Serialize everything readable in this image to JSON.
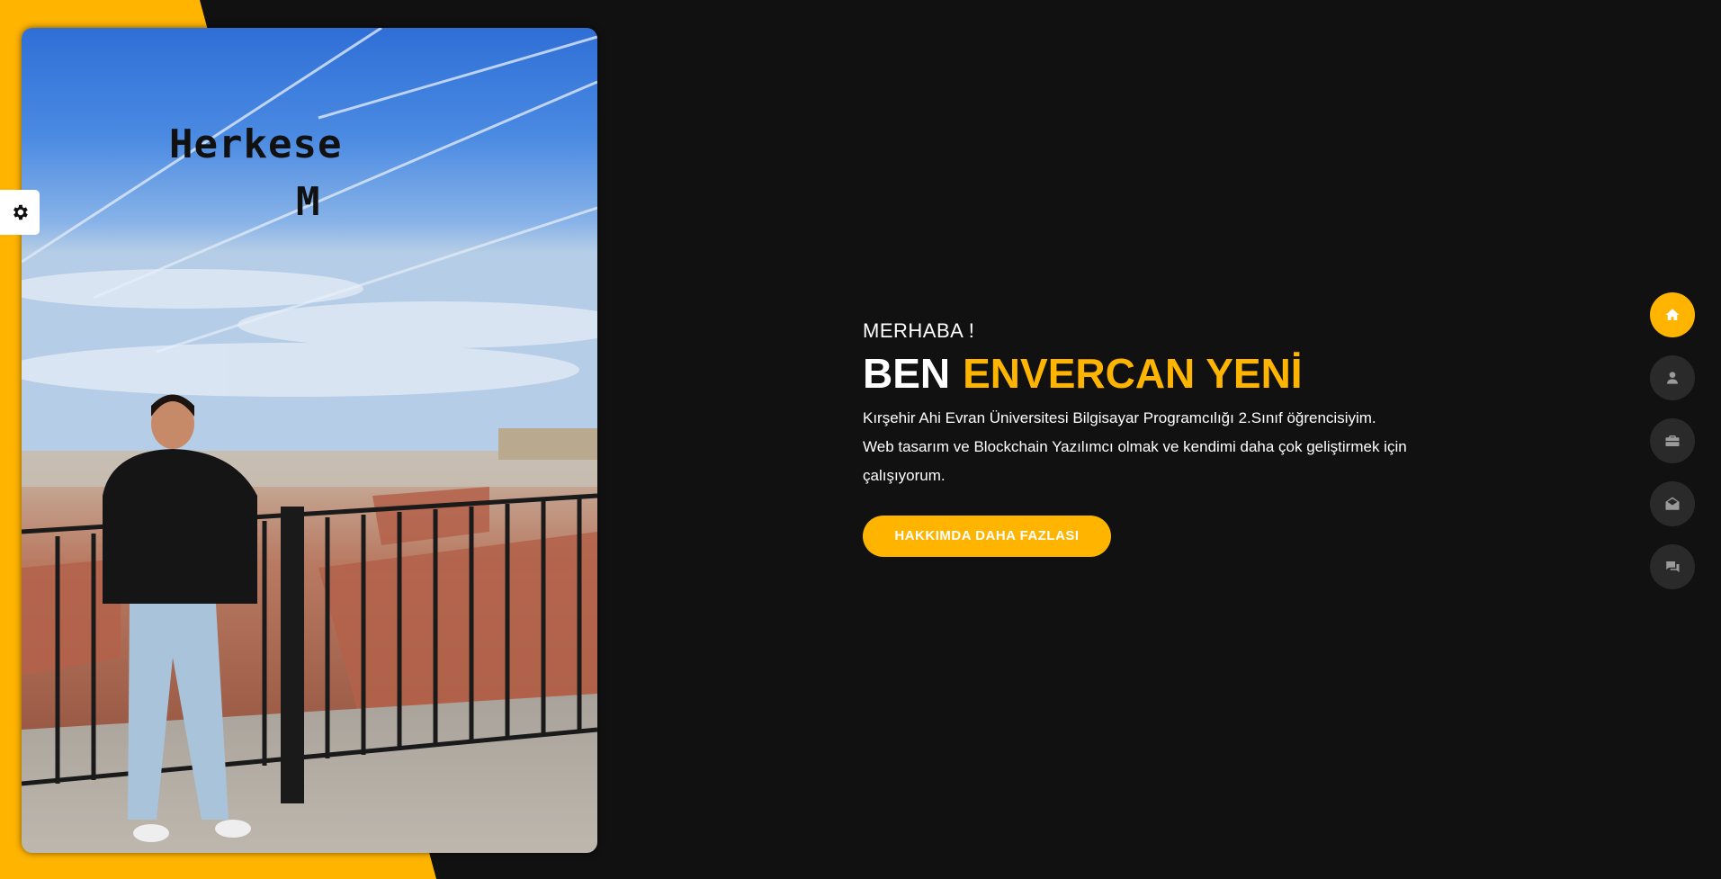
{
  "colors": {
    "accent": "#ffb400",
    "background": "#111111",
    "nav_button": "#2b2a2a",
    "text": "#ffffff"
  },
  "photo": {
    "overlay_line1": "Herkese",
    "overlay_line2": "M"
  },
  "settings": {
    "icon": "gear-icon"
  },
  "hero": {
    "greeting": "MERHABA !",
    "name_prefix": "BEN",
    "name": "ENVERCAN YENİ",
    "description": "Kırşehir Ahi Evran Üniversitesi Bilgisayar Programcılığı 2.Sınıf öğrencisiyim. Web tasarım ve Blockchain Yazılımcı olmak ve kendimi daha çok geliştirmek için çalışıyorum.",
    "cta_label": "HAKKIMDA DAHA FAZLASI"
  },
  "nav": {
    "items": [
      {
        "icon": "home-icon",
        "active": true
      },
      {
        "icon": "user-icon",
        "active": false
      },
      {
        "icon": "briefcase-icon",
        "active": false
      },
      {
        "icon": "envelope-open-icon",
        "active": false
      },
      {
        "icon": "comments-icon",
        "active": false
      }
    ]
  }
}
